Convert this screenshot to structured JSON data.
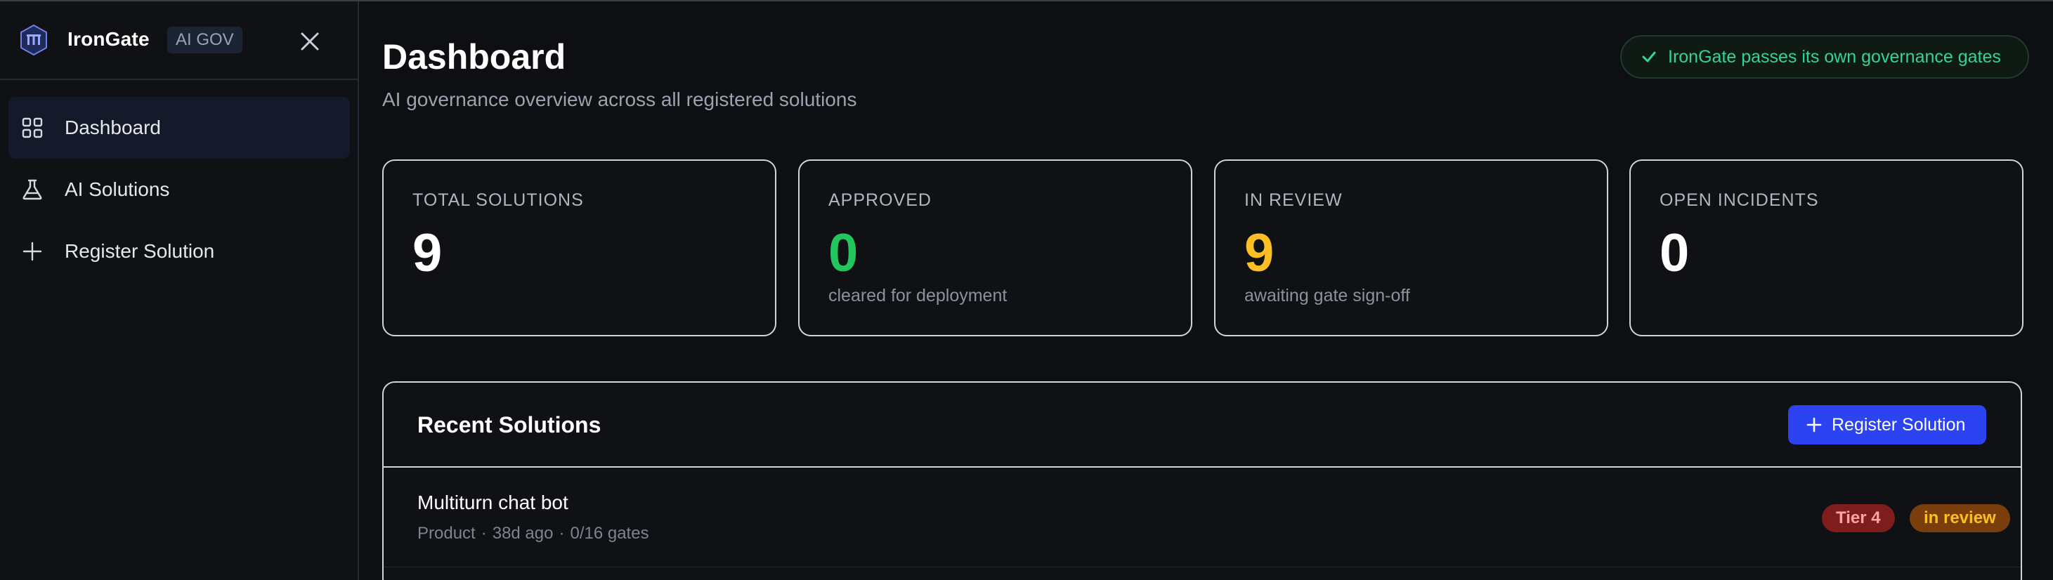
{
  "brand": {
    "name": "IronGate",
    "tag": "AI GOV"
  },
  "nav": {
    "items": [
      {
        "label": "Dashboard",
        "icon": "grid-icon",
        "active": true
      },
      {
        "label": "AI Solutions",
        "icon": "flask-icon",
        "active": false
      },
      {
        "label": "Register Solution",
        "icon": "plus-icon",
        "active": false
      }
    ]
  },
  "header": {
    "title": "Dashboard",
    "subtitle": "AI governance overview across all registered solutions",
    "status_pill": "IronGate passes its own governance gates"
  },
  "stats": [
    {
      "label": "TOTAL SOLUTIONS",
      "value": "9",
      "note": ""
    },
    {
      "label": "APPROVED",
      "value": "0",
      "note": "cleared for deployment"
    },
    {
      "label": "IN REVIEW",
      "value": "9",
      "note": "awaiting gate sign-off"
    },
    {
      "label": "OPEN INCIDENTS",
      "value": "0",
      "note": ""
    }
  ],
  "recent": {
    "title": "Recent Solutions",
    "register_label": "Register Solution",
    "rows": [
      {
        "name": "Multiturn chat bot",
        "category": "Product",
        "age": "38d ago",
        "gates": "0/16 gates",
        "sep": "·",
        "tier": "Tier 4",
        "status": "in review"
      }
    ]
  },
  "colors": {
    "accent": "#2b43f0",
    "success": "#22c55e",
    "warning": "#fbbf24",
    "danger_bg": "#7f1d1d"
  }
}
